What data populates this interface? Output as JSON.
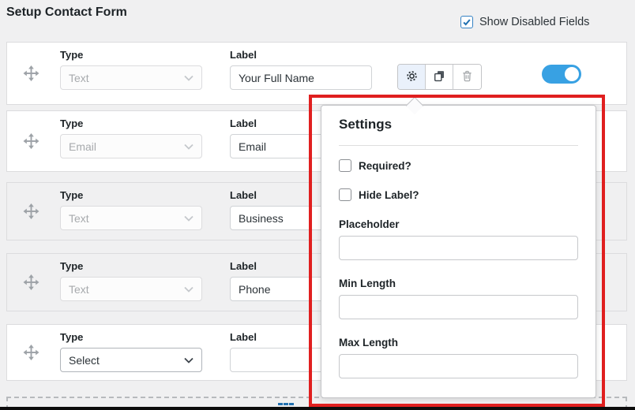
{
  "title": "Setup Contact Form",
  "header": {
    "show_disabled": {
      "label": "Show Disabled Fields",
      "checked": true
    }
  },
  "row_captions": {
    "type": "Type",
    "label": "Label"
  },
  "rows": [
    {
      "type": "Text",
      "label": "Your Full Name",
      "type_disabled": true,
      "row_disabled": false,
      "toggle_on": true
    },
    {
      "type": "Email",
      "label": "Email",
      "type_disabled": true,
      "row_disabled": false
    },
    {
      "type": "Text",
      "label": "Business",
      "type_disabled": true,
      "row_disabled": true
    },
    {
      "type": "Text",
      "label": "Phone",
      "type_disabled": true,
      "row_disabled": true
    },
    {
      "type": "Select",
      "label": "",
      "type_disabled": false,
      "row_disabled": false
    }
  ],
  "row_actions": {
    "settings": "gear-icon",
    "duplicate": "copy-icon",
    "delete": "trash-icon"
  },
  "popover": {
    "title": "Settings",
    "checkboxes": [
      {
        "label": "Required?",
        "checked": false
      },
      {
        "label": "Hide Label?",
        "checked": false
      }
    ],
    "fields": [
      {
        "label": "Placeholder",
        "value": ""
      },
      {
        "label": "Min Length",
        "value": ""
      },
      {
        "label": "Max Length",
        "value": ""
      }
    ]
  },
  "colors": {
    "toggle_on": "#38a1e3",
    "highlight_border": "#e01f1f",
    "active_action_bg": "#eaf1fb",
    "checkbox_accent": "#2271b1",
    "page_background": "#f0f0f1"
  }
}
